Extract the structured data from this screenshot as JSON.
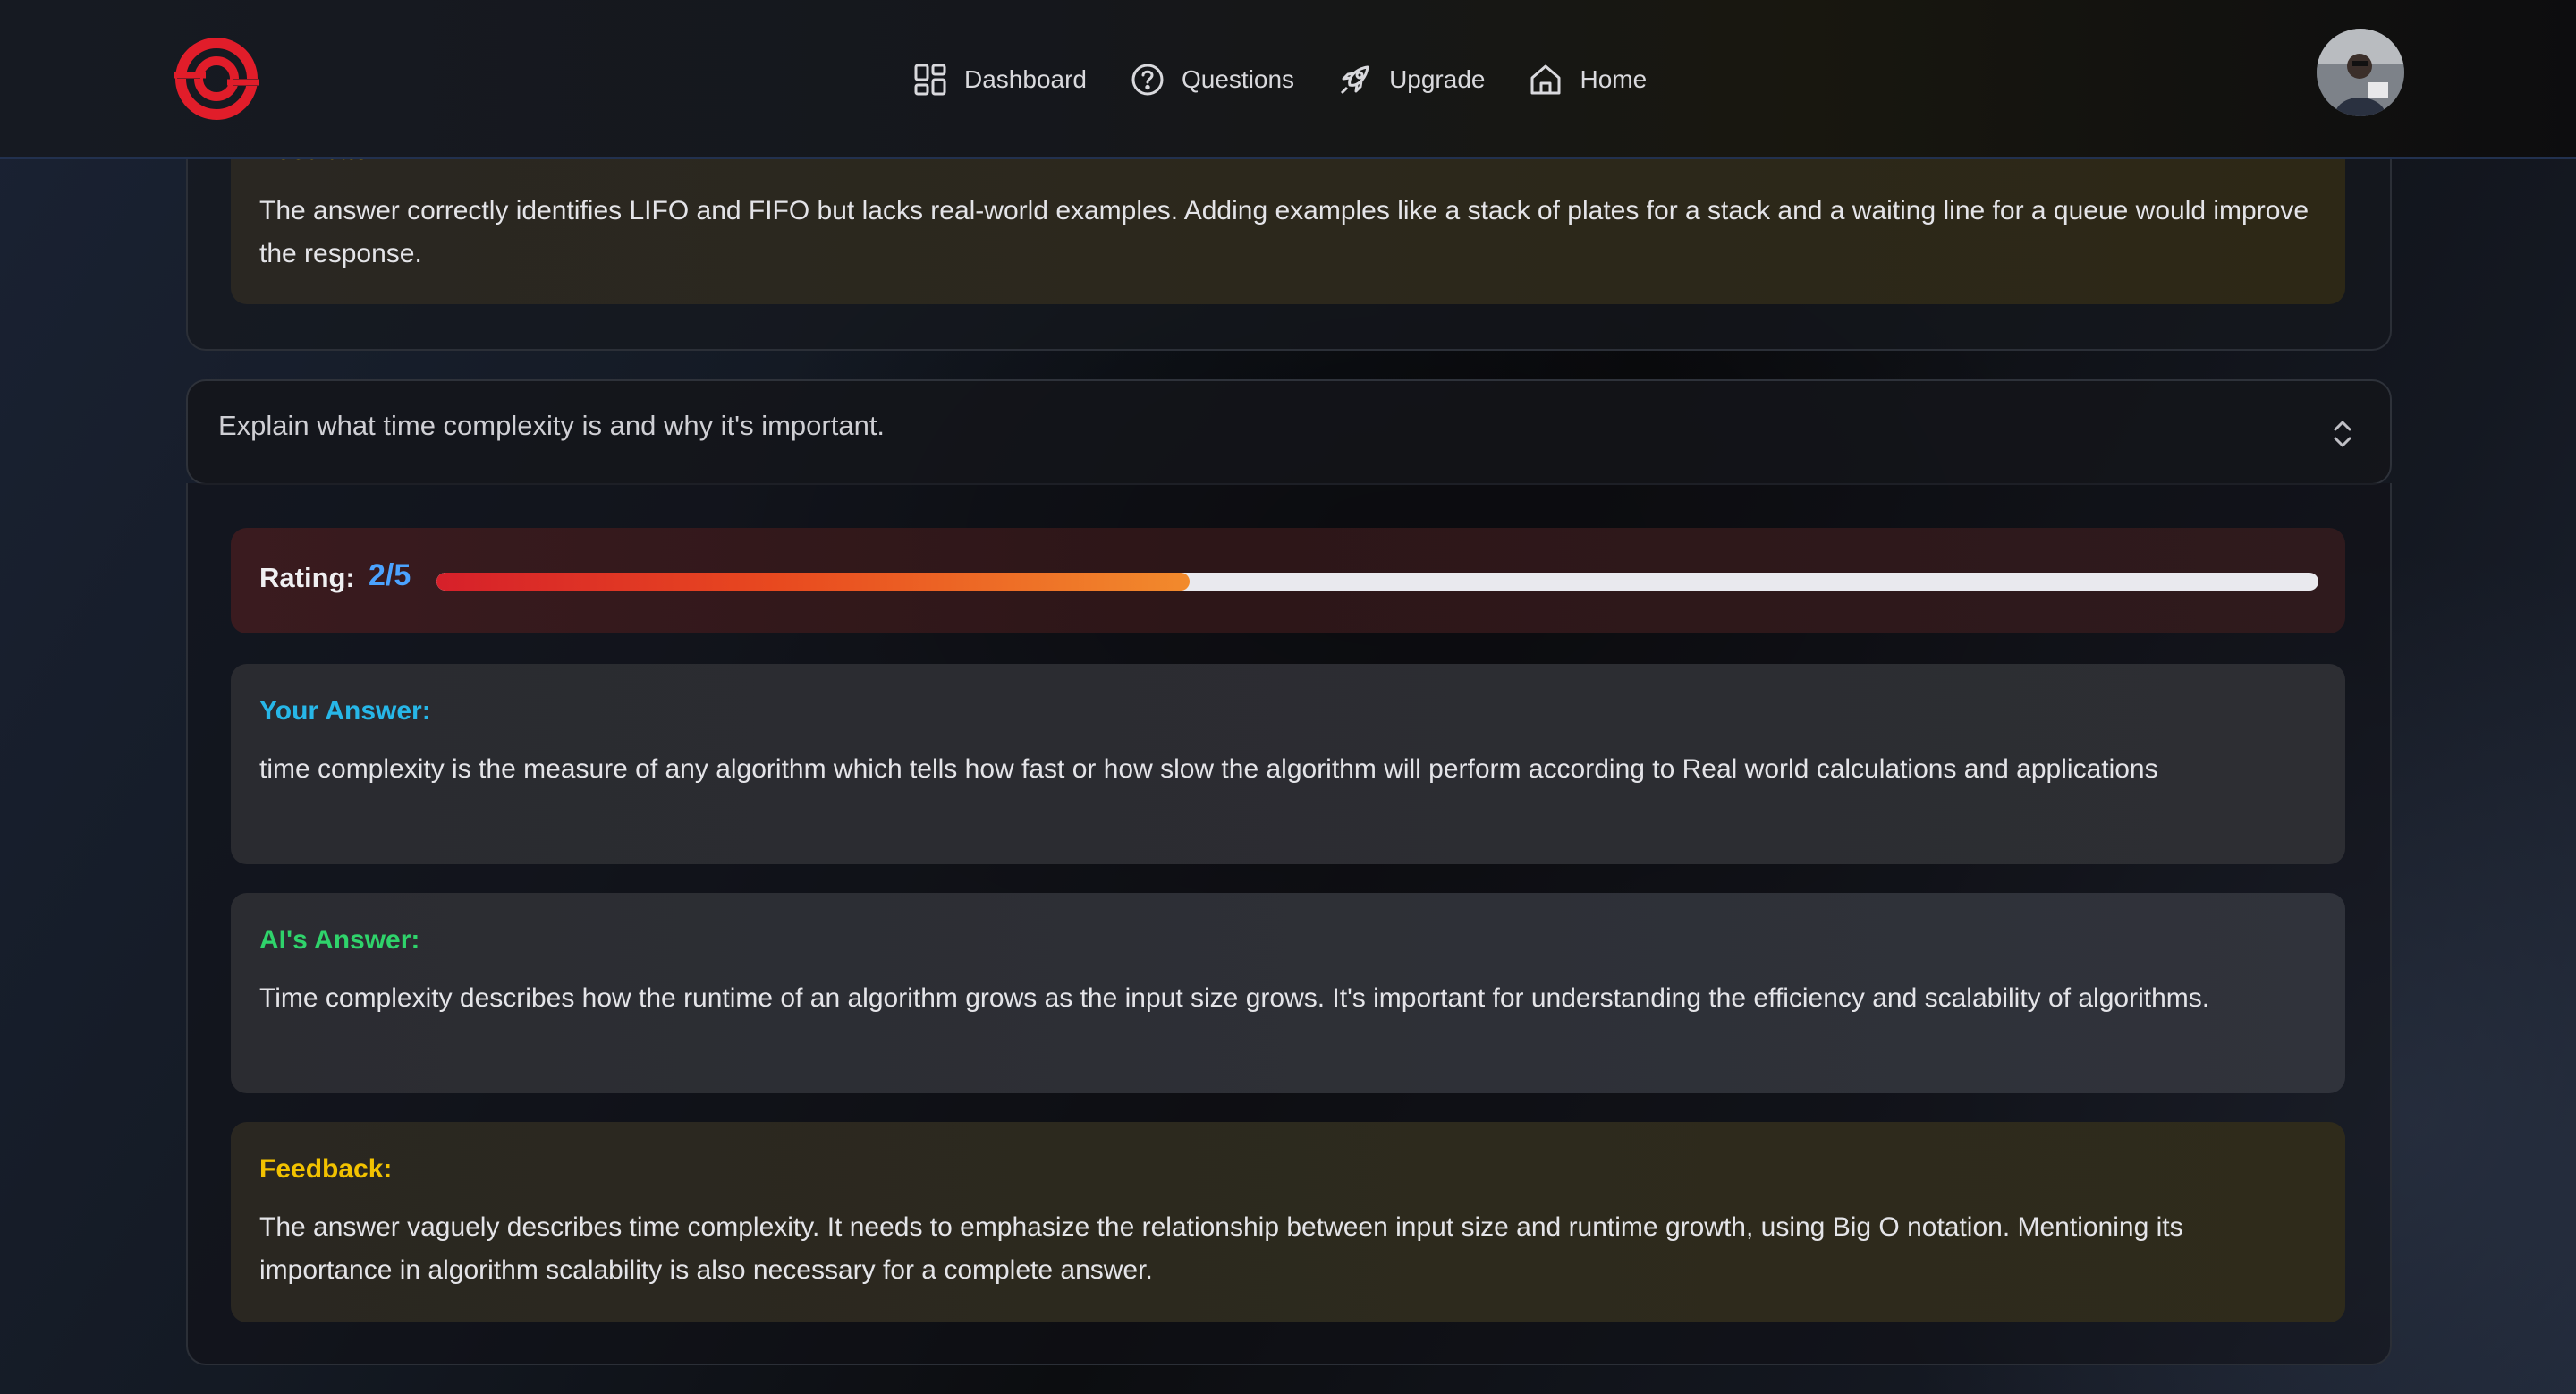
{
  "header": {
    "nav": [
      {
        "label": "Dashboard",
        "icon": "grid-icon"
      },
      {
        "label": "Questions",
        "icon": "question-circle-icon"
      },
      {
        "label": "Upgrade",
        "icon": "rocket-icon"
      },
      {
        "label": "Home",
        "icon": "home-icon"
      }
    ]
  },
  "previous_item": {
    "feedback_label": "Feedback:",
    "feedback_text": "The answer correctly identifies LIFO and FIFO but lacks real-world examples. Adding examples like a stack of plates for a stack and a waiting line for a queue would improve the response."
  },
  "current_item": {
    "question": "Explain what time complexity is and why it's important.",
    "rating_label": "Rating:",
    "rating_value": "2/5",
    "rating_fraction": 0.4,
    "your_answer_label": "Your Answer:",
    "your_answer_text": "time complexity is the measure of any algorithm which tells how fast or how slow the algorithm will perform according to Real world calculations and applications",
    "ai_answer_label": "AI's Answer:",
    "ai_answer_text": "Time complexity describes how the runtime of an algorithm grows as the input size grows. It's important for understanding the efficiency and scalability of algorithms.",
    "feedback_label": "Feedback:",
    "feedback_text": "The answer vaguely describes time complexity. It needs to emphasize the relationship between input size and runtime growth, using Big O notation. Mentioning its importance in algorithm scalability is also necessary for a complete answer."
  },
  "colors": {
    "accent_red": "#e11d2a",
    "rating_blue": "#4ba3ff",
    "your_answer_cyan": "#27b7e8",
    "ai_answer_green": "#2fd36b",
    "feedback_yellow": "#f2c200"
  }
}
